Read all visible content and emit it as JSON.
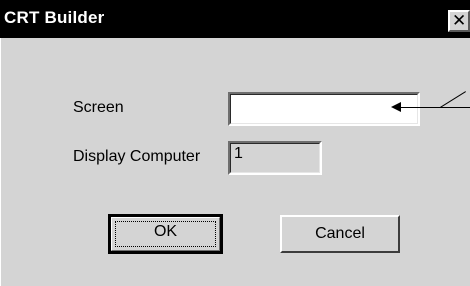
{
  "window": {
    "title": "CRT Builder",
    "close_symbol": "✕"
  },
  "form": {
    "screen_label": "Screen",
    "screen_value": "",
    "display_computer_label": "Display Computer",
    "display_computer_value": "1"
  },
  "buttons": {
    "ok_label": "OK",
    "cancel_label": "Cancel"
  },
  "icons": {
    "close": "close-icon"
  }
}
